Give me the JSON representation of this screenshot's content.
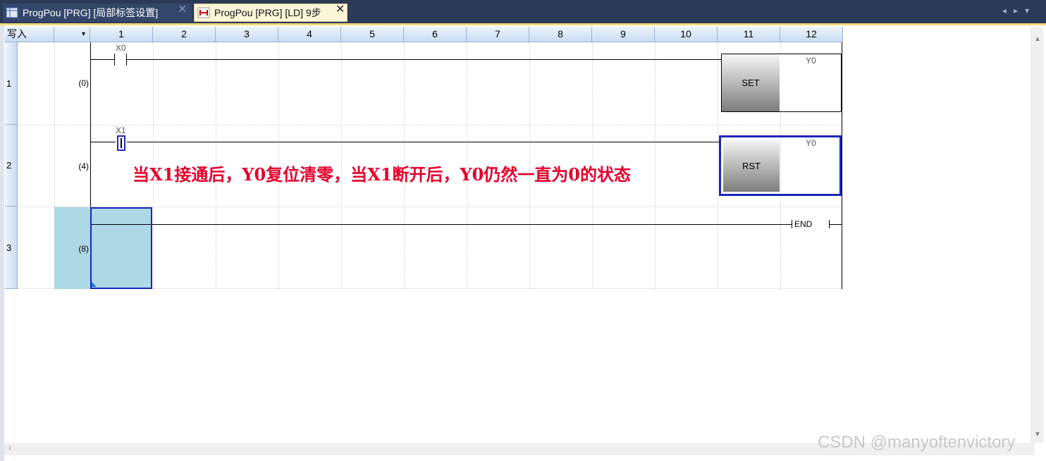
{
  "tabs": [
    {
      "label": "ProgPou [PRG] [局部标签设置]",
      "close": "✕",
      "icon": "table-icon"
    },
    {
      "label": "ProgPou [PRG] [LD] 9步",
      "close": "✕",
      "icon": "ladder-icon"
    }
  ],
  "grid": {
    "mode_label": "写入",
    "mode_dropdown": "▾",
    "columns": [
      "1",
      "2",
      "3",
      "4",
      "5",
      "6",
      "7",
      "8",
      "9",
      "10",
      "11",
      "12"
    ],
    "rows": [
      {
        "num": "1",
        "step": "(0)"
      },
      {
        "num": "2",
        "step": "(4)"
      },
      {
        "num": "3",
        "step": "(8)"
      }
    ]
  },
  "ladder": {
    "rung1": {
      "contact": "X0",
      "instruction": "SET",
      "device": "Y0"
    },
    "rung2": {
      "contact": "X1",
      "instruction": "RST",
      "device": "Y0"
    },
    "rung3": {
      "instruction": "END"
    }
  },
  "annotation": "当X1接通后，Y0复位清零，当X1断开后，Y0仍然一直为0的状态",
  "watermark": "CSDN @manyoftenvictory",
  "colors": {
    "selection": "#1b26b8",
    "annotation": "#e4002b",
    "cursor_fill": "#add8e6"
  }
}
